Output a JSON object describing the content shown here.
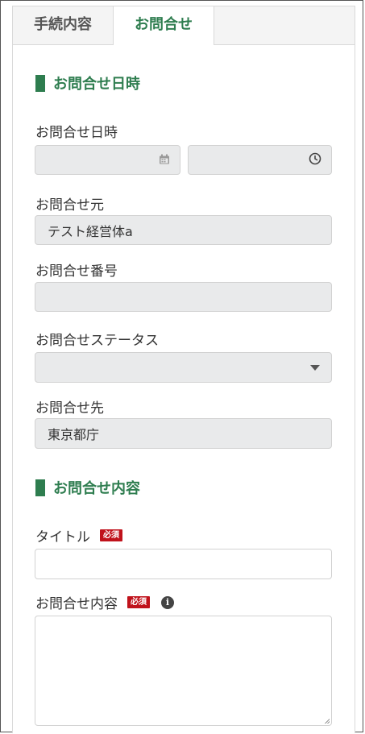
{
  "tabs": [
    {
      "label": "手続内容",
      "active": false
    },
    {
      "label": "お問合せ",
      "active": true
    }
  ],
  "section_datetime": {
    "title": "お問合せ日時"
  },
  "datetime": {
    "label": "お問合せ日時",
    "date_value": "",
    "time_value": "",
    "date_icon": "calendar-icon",
    "time_icon": "clock-icon"
  },
  "source": {
    "label": "お問合せ元",
    "value": "テスト経営体a"
  },
  "number": {
    "label": "お問合せ番号",
    "value": ""
  },
  "status": {
    "label": "お問合せステータス",
    "value": ""
  },
  "destination": {
    "label": "お問合せ先",
    "value": "東京都庁"
  },
  "section_content": {
    "title": "お問合せ内容"
  },
  "title_field": {
    "label": "タイトル",
    "required": "必須",
    "value": ""
  },
  "content_field": {
    "label": "お問合せ内容",
    "required": "必須",
    "info": "i",
    "value": ""
  },
  "colors": {
    "accent": "#2e7d4f",
    "required_badge": "#c0121b",
    "readonly_bg": "#e9eaeb"
  }
}
